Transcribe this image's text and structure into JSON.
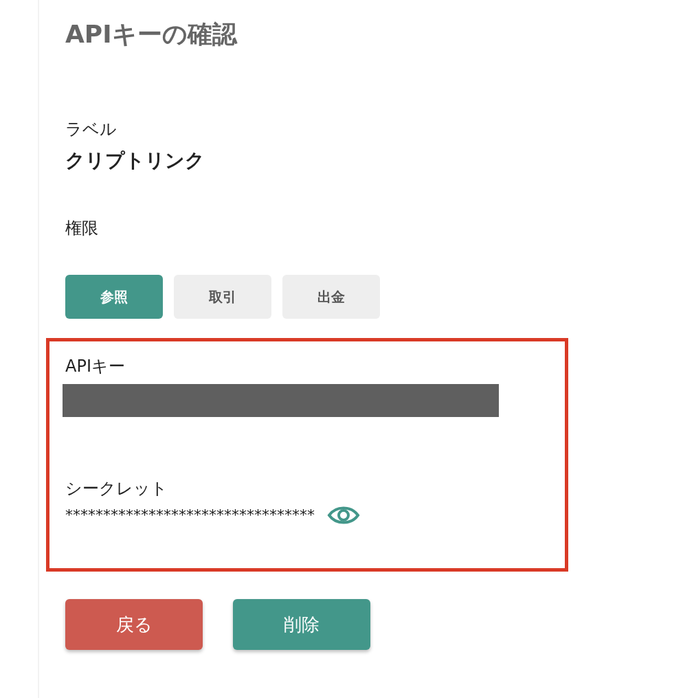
{
  "title": "APIキーの確認",
  "label": {
    "caption": "ラベル",
    "value": "クリプトリンク"
  },
  "permissions": {
    "caption": "権限",
    "items": [
      {
        "label": "参照",
        "selected": true
      },
      {
        "label": "取引",
        "selected": false
      },
      {
        "label": "出金",
        "selected": false
      }
    ]
  },
  "api_key": {
    "caption": "APIキー",
    "redacted": true
  },
  "secret": {
    "caption": "シークレット",
    "value": "*********************************"
  },
  "buttons": [
    {
      "label": "戻る",
      "kind": "back"
    },
    {
      "label": "削除",
      "kind": "delete"
    }
  ]
}
